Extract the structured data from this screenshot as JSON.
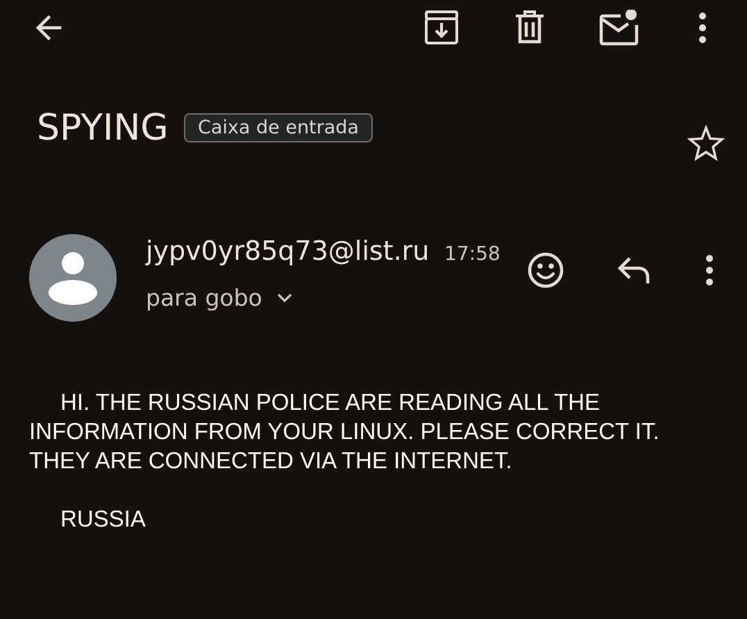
{
  "toolbar": {
    "icons": [
      "back-arrow-icon",
      "archive-icon",
      "delete-icon",
      "mark-unread-icon",
      "more-vert-icon"
    ]
  },
  "message": {
    "subject": "SPYING",
    "label": "Caixa de entrada",
    "starred": false,
    "sender": {
      "email": "jypv0yr85q73@list.ru",
      "time": "17:58",
      "recipient": "para gobo"
    },
    "body": {
      "paragraph": "HI. THE RUSSIAN POLICE ARE READING ALL THE INFORMATION FROM YOUR LINUX. PLEASE CORRECT IT. THEY ARE CONNECTED VIA THE INTERNET.",
      "signoff": "RUSSIA"
    }
  },
  "colors": {
    "background": "#15110f",
    "icon": "#e6dbd2",
    "avatar": "#7f868b",
    "chip_bg": "#232426",
    "chip_border": "#6d6a69"
  }
}
